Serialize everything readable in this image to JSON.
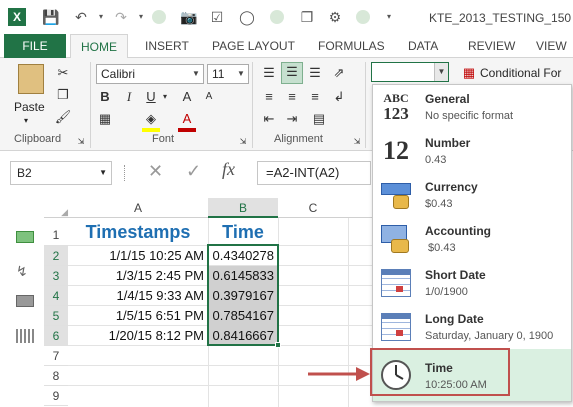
{
  "window": {
    "title": "KTE_2013_TESTING_150"
  },
  "tabs": [
    "FILE",
    "HOME",
    "INSERT",
    "PAGE LAYOUT",
    "FORMULAS",
    "DATA",
    "REVIEW",
    "VIEW"
  ],
  "ribbon": {
    "paste_label": "Paste",
    "font_name": "Calibri",
    "font_size": "11",
    "bold": "B",
    "italic": "I",
    "underline": "U",
    "conditional_formatting": "Conditional For",
    "groups": {
      "clipboard": "Clipboard",
      "font": "Font",
      "alignment": "Alignment"
    }
  },
  "formula_bar": {
    "name_box": "B2",
    "fx": "fx",
    "formula": "=A2-INT(A2)"
  },
  "sheet": {
    "col_headers": [
      "A",
      "B",
      "C"
    ],
    "row_headers": [
      "1",
      "2",
      "3",
      "4",
      "5",
      "6",
      "7",
      "8",
      "9"
    ],
    "header_a": "Timestamps",
    "header_b": "Time",
    "rows": [
      {
        "a": "1/1/15 10:25 AM",
        "b": "0.4340278"
      },
      {
        "a": "1/3/15 2:45 PM",
        "b": "0.6145833"
      },
      {
        "a": "1/4/15 9:33 AM",
        "b": "0.3979167"
      },
      {
        "a": "1/5/15 6:51 PM",
        "b": "0.7854167"
      },
      {
        "a": "1/20/15 8:12 PM",
        "b": "0.8416667"
      }
    ]
  },
  "number_format_menu": {
    "items": [
      {
        "name": "General",
        "example": "No specific format",
        "icon": "general-abc123-icon"
      },
      {
        "name": "Number",
        "example": "0.43",
        "icon": "number-12-icon"
      },
      {
        "name": "Currency",
        "example": "$0.43",
        "icon": "currency-icon"
      },
      {
        "name": "Accounting",
        "example": " $0.43",
        "icon": "accounting-icon"
      },
      {
        "name": "Short Date",
        "example": "1/0/1900",
        "icon": "calendar-icon"
      },
      {
        "name": "Long Date",
        "example": "Saturday, January 0, 1900",
        "icon": "calendar-icon"
      },
      {
        "name": "Time",
        "example": "10:25:00 AM",
        "icon": "clock-icon"
      }
    ],
    "icon_text": {
      "general_top": "ABC",
      "general_bottom": "123",
      "number": "12"
    },
    "highlight_color": "#daf0e1",
    "callout_color": "#c0504d"
  },
  "colors": {
    "excel_green": "#217346",
    "header_blue": "#1f6fb2"
  }
}
